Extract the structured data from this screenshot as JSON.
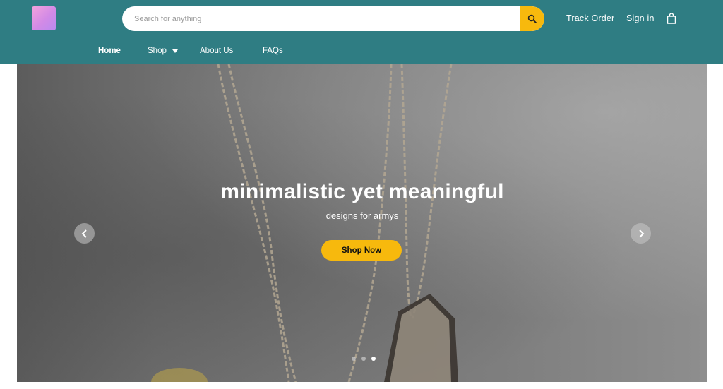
{
  "header": {
    "logo_icon": "crescent-moon-icon",
    "search": {
      "placeholder": "Search for anything",
      "value": "",
      "icon": "search-icon"
    },
    "links": {
      "track_order": "Track Order",
      "sign_in": "Sign in"
    },
    "cart_icon": "shopping-bag-icon"
  },
  "nav": {
    "items": [
      {
        "label": "Home",
        "active": true
      },
      {
        "label": "Shop",
        "has_dropdown": true
      },
      {
        "label": "About Us"
      },
      {
        "label": "FAQs"
      }
    ]
  },
  "hero": {
    "title": "minimalistic yet meaningful",
    "subtitle": "designs for armys",
    "cta_label": "Shop Now",
    "prev_icon": "chevron-left-icon",
    "next_icon": "chevron-right-icon",
    "slides_count": 3,
    "active_slide": 3
  },
  "colors": {
    "header_bg": "#2f7d83",
    "accent": "#f7b90d",
    "text_on_dark": "#ffffff"
  }
}
